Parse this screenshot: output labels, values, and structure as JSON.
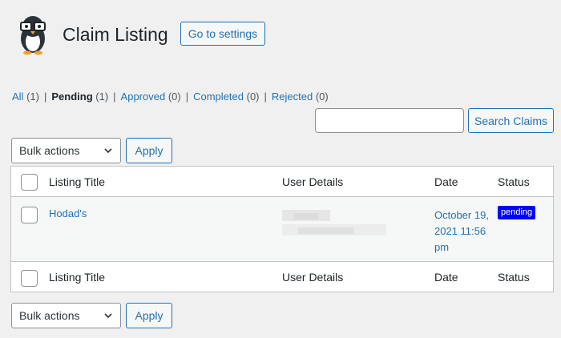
{
  "header": {
    "title": "Claim Listing",
    "settings_button": "Go to settings"
  },
  "filters": [
    {
      "label": "All",
      "count": "(1)",
      "current": false
    },
    {
      "label": "Pending",
      "count": "(1)",
      "current": true
    },
    {
      "label": "Approved",
      "count": "(0)",
      "current": false
    },
    {
      "label": "Completed",
      "count": "(0)",
      "current": false
    },
    {
      "label": "Rejected",
      "count": "(0)",
      "current": false
    }
  ],
  "search": {
    "value": "",
    "button": "Search Claims"
  },
  "bulk": {
    "selected": "Bulk actions",
    "apply": "Apply"
  },
  "table": {
    "columns": [
      "Listing Title",
      "User Details",
      "Date",
      "Status"
    ],
    "rows": [
      {
        "title": "Hodad's",
        "date": "October 19, 2021 11:56 pm",
        "status": "pending"
      }
    ]
  },
  "colors": {
    "accent": "#2271b1",
    "badge": "#0000ff",
    "background": "#f0f0f1"
  }
}
